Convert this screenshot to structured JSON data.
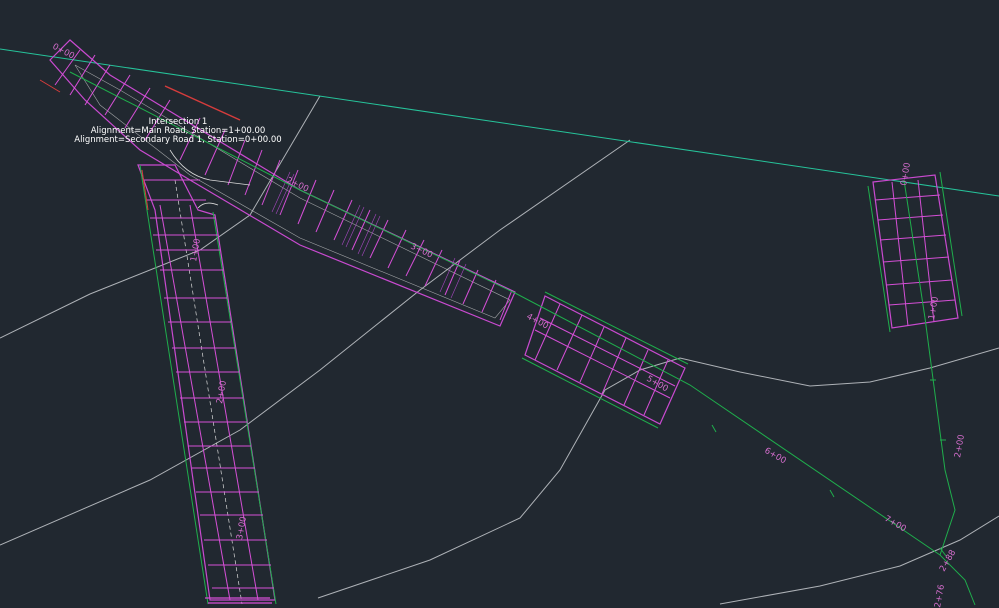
{
  "intersection": {
    "title": "Intersection 1",
    "alignment_main": "Alignment=Main Road, Station=1+00.00",
    "alignment_secondary": "Alignment=Secondary Road 1, Station=0+00.00"
  },
  "main_road": {
    "stations": [
      "0+00",
      "2+00",
      "3+00",
      "4+00",
      "5+00",
      "6+00",
      "7+00",
      "2+88"
    ]
  },
  "secondary_road": {
    "stations": [
      "1+00",
      "2+00",
      "3+00"
    ]
  },
  "side_road": {
    "stations": [
      "0+00",
      "1+00",
      "2+00",
      "2+76"
    ]
  },
  "colors": {
    "background": "#212830",
    "corridor": "#d54fd6",
    "alignment": "#1fae4c",
    "surface_line": "#b9bcc0",
    "boundary": "#27c39a",
    "edge_red": "#d63c3c"
  }
}
